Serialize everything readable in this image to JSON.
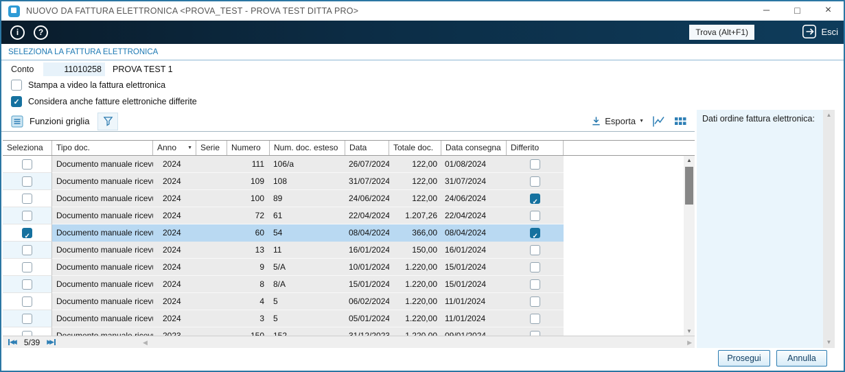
{
  "window": {
    "title": "NUOVO DA FATTURA ELETTRONICA <PROVA_TEST - PROVA TEST DITTA PRO>"
  },
  "icons": {
    "minimize": "─",
    "maximize": "□",
    "close": "×",
    "info": "i",
    "help": "?",
    "caret_down": "▼",
    "arrow_up": "▲",
    "arrow_down": "▼",
    "arrow_left": "◀",
    "arrow_right": "▶",
    "first_page": "◀◀",
    "last_page": "▶▶"
  },
  "toolbar": {
    "trova_label": "Trova (Alt+F1)",
    "esci_label": "Esci"
  },
  "section_title": "SELEZIONA LA FATTURA ELETTRONICA",
  "conto": {
    "label": "Conto",
    "value": "11010258",
    "name": "PROVA TEST 1"
  },
  "options": [
    {
      "label": "Stampa a video la fattura elettronica",
      "checked": false
    },
    {
      "label": "Considera anche fatture elettroniche differite",
      "checked": true
    }
  ],
  "grid_toolbar": {
    "funzioni_label": "Funzioni griglia",
    "esporta_label": "Esporta"
  },
  "side_panel": {
    "title": "Dati ordine fattura elettronica:"
  },
  "table": {
    "headers": {
      "seleziona": "Seleziona",
      "tipo": "Tipo doc.",
      "anno": "Anno",
      "serie": "Serie",
      "numero": "Numero",
      "esteso": "Num. doc. esteso",
      "data": "Data",
      "totale": "Totale doc.",
      "consegna": "Data consegna",
      "differito": "Differito"
    },
    "rows": [
      {
        "selected": false,
        "tipo": "Documento manuale ricevuto",
        "anno": "2024",
        "serie": "",
        "numero": "111",
        "esteso": "106/a",
        "data": "26/07/2024",
        "totale": "122,00",
        "consegna": "01/08/2024",
        "differito": false,
        "highlighted": false
      },
      {
        "selected": false,
        "tipo": "Documento manuale ricevuto",
        "anno": "2024",
        "serie": "",
        "numero": "109",
        "esteso": "108",
        "data": "31/07/2024",
        "totale": "122,00",
        "consegna": "31/07/2024",
        "differito": false,
        "highlighted": false
      },
      {
        "selected": false,
        "tipo": "Documento manuale ricevuto",
        "anno": "2024",
        "serie": "",
        "numero": "100",
        "esteso": "89",
        "data": "24/06/2024",
        "totale": "122,00",
        "consegna": "24/06/2024",
        "differito": true,
        "highlighted": false
      },
      {
        "selected": false,
        "tipo": "Documento manuale ricevuto",
        "anno": "2024",
        "serie": "",
        "numero": "72",
        "esteso": "61",
        "data": "22/04/2024",
        "totale": "1.207,26",
        "consegna": "22/04/2024",
        "differito": false,
        "highlighted": false
      },
      {
        "selected": true,
        "tipo": "Documento manuale ricevuto",
        "anno": "2024",
        "serie": "",
        "numero": "60",
        "esteso": "54",
        "data": "08/04/2024",
        "totale": "366,00",
        "consegna": "08/04/2024",
        "differito": true,
        "highlighted": true
      },
      {
        "selected": false,
        "tipo": "Documento manuale ricevuto",
        "anno": "2024",
        "serie": "",
        "numero": "13",
        "esteso": "11",
        "data": "16/01/2024",
        "totale": "150,00",
        "consegna": "16/01/2024",
        "differito": false,
        "highlighted": false
      },
      {
        "selected": false,
        "tipo": "Documento manuale ricevuto",
        "anno": "2024",
        "serie": "",
        "numero": "9",
        "esteso": "5/A",
        "data": "10/01/2024",
        "totale": "1.220,00",
        "consegna": "15/01/2024",
        "differito": false,
        "highlighted": false
      },
      {
        "selected": false,
        "tipo": "Documento manuale ricevuto",
        "anno": "2024",
        "serie": "",
        "numero": "8",
        "esteso": "8/A",
        "data": "15/01/2024",
        "totale": "1.220,00",
        "consegna": "15/01/2024",
        "differito": false,
        "highlighted": false
      },
      {
        "selected": false,
        "tipo": "Documento manuale ricevuto",
        "anno": "2024",
        "serie": "",
        "numero": "4",
        "esteso": "5",
        "data": "06/02/2024",
        "totale": "1.220,00",
        "consegna": "11/01/2024",
        "differito": false,
        "highlighted": false
      },
      {
        "selected": false,
        "tipo": "Documento manuale ricevuto",
        "anno": "2024",
        "serie": "",
        "numero": "3",
        "esteso": "5",
        "data": "05/01/2024",
        "totale": "1.220,00",
        "consegna": "11/01/2024",
        "differito": false,
        "highlighted": false
      },
      {
        "selected": false,
        "tipo": "Documento manuale ricevuto",
        "anno": "2023",
        "serie": "",
        "numero": "150",
        "esteso": "152",
        "data": "31/12/2023",
        "totale": "1.220,00",
        "consegna": "09/01/2024",
        "differito": false,
        "highlighted": false
      }
    ]
  },
  "pagination": {
    "position": "5/39"
  },
  "actions": {
    "prosegui": "Prosegui",
    "annulla": "Annulla"
  },
  "colors": {
    "accent": "#15719f",
    "toolbar_bg": "#0c2d46",
    "row_highlight": "#b9d9f2",
    "panel_bg": "#eaf5fc",
    "section_title": "#1b78b3"
  }
}
